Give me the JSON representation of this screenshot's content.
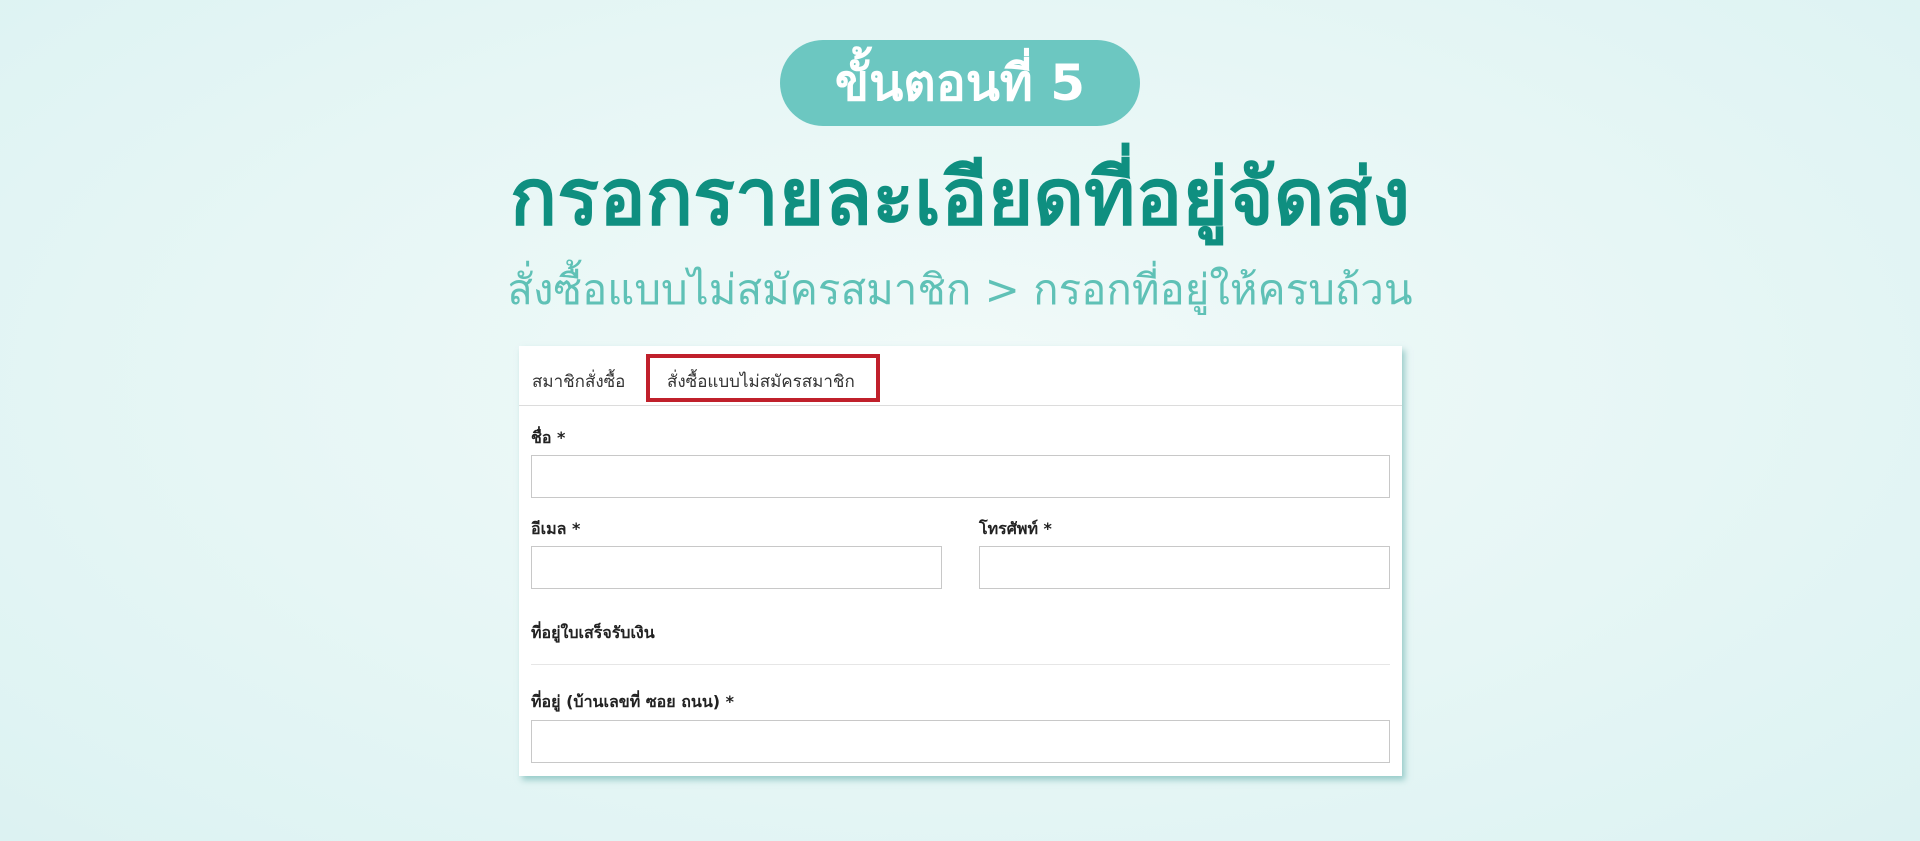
{
  "banner": {
    "step_label": "ขั้นตอนที่ 5",
    "headline": "กรอกรายละเอียดที่อยู่จัดส่ง",
    "subline": "สั่งซื้อแบบไม่สมัครสมาชิก > กรอกที่อยู่ให้ครบถ้วน"
  },
  "form": {
    "tabs": [
      {
        "label": "สมาชิกสั่งซื้อ"
      },
      {
        "label": "สั่งซื้อแบบไม่สมัครสมาชิก",
        "highlighted": true
      }
    ],
    "fields": {
      "name": {
        "label": "ชื่อ *",
        "value": ""
      },
      "email": {
        "label": "อีเมล *",
        "value": ""
      },
      "phone": {
        "label": "โทรศัพท์ *",
        "value": ""
      },
      "address": {
        "label": "ที่อยู่ (บ้านเลขที่ ซอย ถนน) *",
        "value": ""
      }
    },
    "billing_section_title": "ที่อยู่ใบเสร็จรับเงิน"
  },
  "colors": {
    "pill": "#6cc7c1",
    "headline": "#0f8f80",
    "subline": "#5fc1b6",
    "tab_highlight": "#c0202b"
  }
}
